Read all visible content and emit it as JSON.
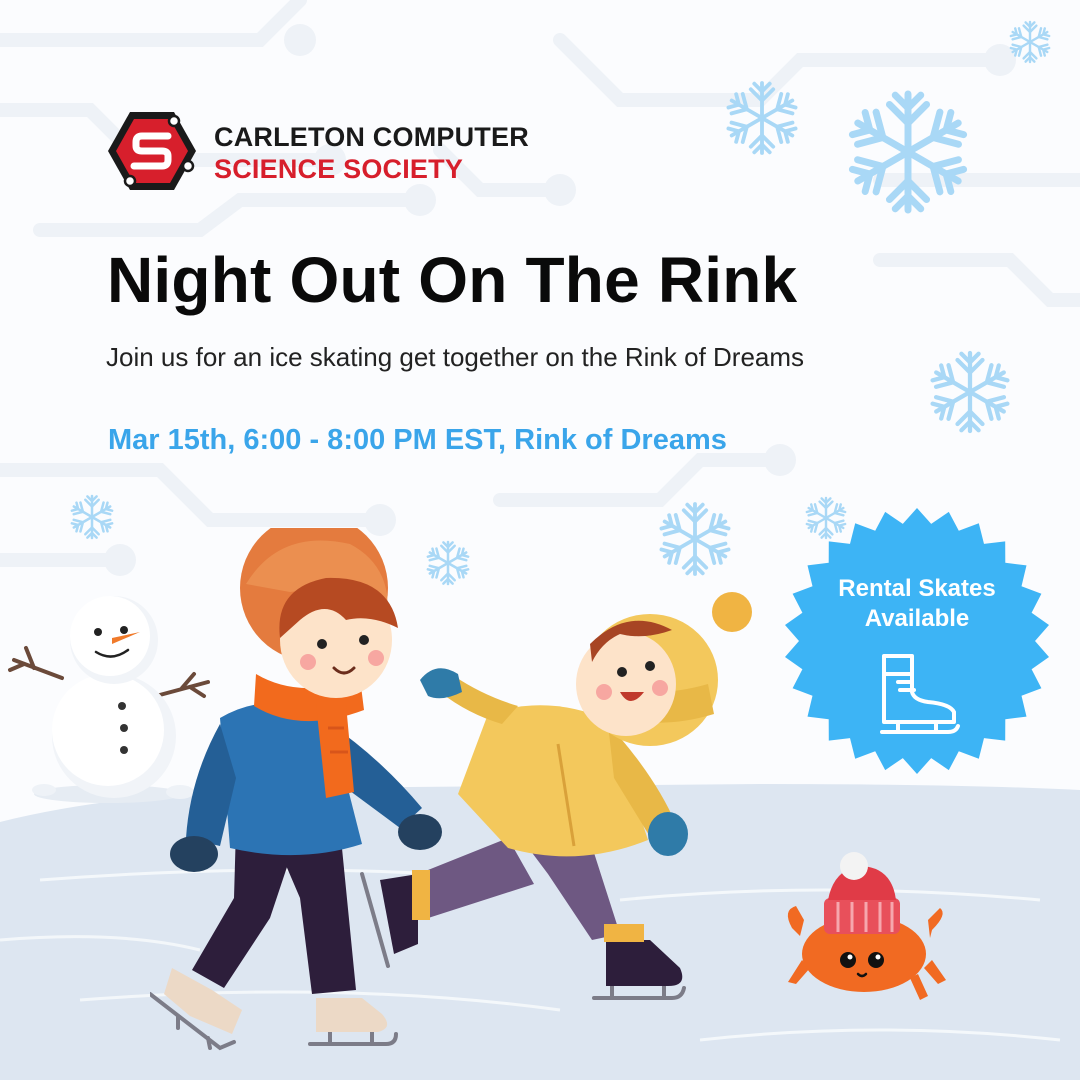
{
  "organization": {
    "line1": "CARLETON COMPUTER",
    "line2": "SCIENCE SOCIETY",
    "logo_icon": "s-circuit-logo-icon"
  },
  "event": {
    "title": "Night Out On The Rink",
    "subtitle": "Join us for an ice skating get together on the Rink of Dreams",
    "details": "Mar 15th, 6:00 - 8:00 PM EST, Rink of Dreams"
  },
  "badge": {
    "line1": "Rental Skates",
    "line2": "Available",
    "icon": "ice-skate-icon"
  },
  "colors": {
    "title": "#0a0a0a",
    "brand_red": "#d71f2c",
    "accent_blue": "#3aa5ea",
    "badge_blue": "#3db4f5",
    "snowflake": "#a9d8f6",
    "ice": "#dde6f1"
  }
}
